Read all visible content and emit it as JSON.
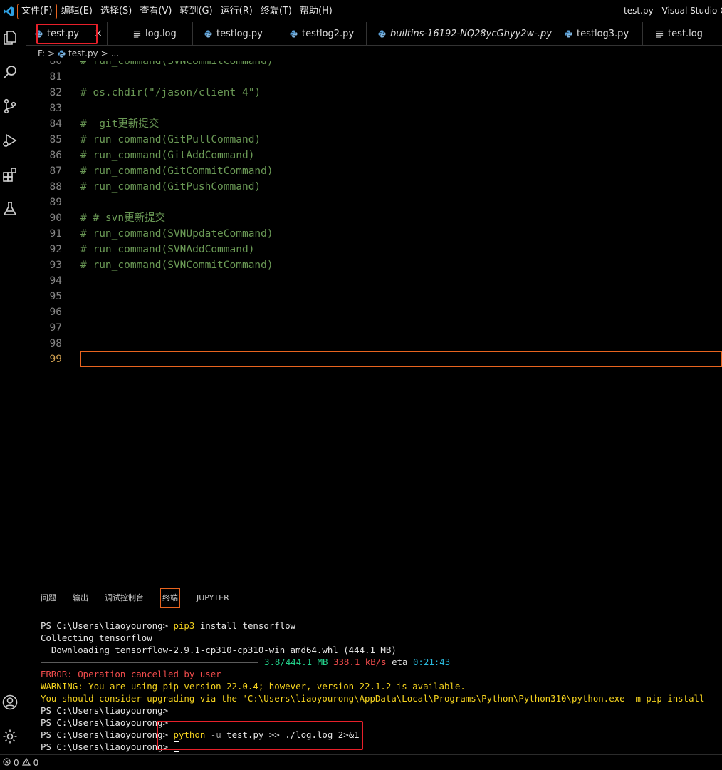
{
  "menu": {
    "items": [
      "文件(F)",
      "编辑(E)",
      "选择(S)",
      "查看(V)",
      "转到(G)",
      "运行(R)",
      "终端(T)",
      "帮助(H)"
    ],
    "window_title": "test.py - Visual Studio Code"
  },
  "tabs": [
    {
      "label": "test.py",
      "icon": "python-file-icon",
      "italic": false
    },
    {
      "label": "log.log",
      "icon": "text-file-icon",
      "italic": false
    },
    {
      "label": "testlog.py",
      "icon": "python-file-icon",
      "italic": false
    },
    {
      "label": "testlog2.py",
      "icon": "python-file-icon",
      "italic": false
    },
    {
      "label": "builtins-16192-NQ28ycGhyy2w-.py",
      "icon": "python-file-icon",
      "italic": true
    },
    {
      "label": "testlog3.py",
      "icon": "python-file-icon",
      "italic": false
    },
    {
      "label": "test.log",
      "icon": "text-file-icon",
      "italic": false
    }
  ],
  "tab_close": "×",
  "breadcrumb": {
    "drive": "F:",
    "sep": ">",
    "file": "test.py",
    "more": "..."
  },
  "editor": {
    "lines": [
      {
        "num": "80",
        "code": "# run_command(SVNCommitCommand)"
      },
      {
        "num": "81",
        "code": ""
      },
      {
        "num": "82",
        "code": "# os.chdir(\"/jason/client_4\")"
      },
      {
        "num": "83",
        "code": ""
      },
      {
        "num": "84",
        "code": "#  git更新提交"
      },
      {
        "num": "85",
        "code": "# run_command(GitPullCommand)"
      },
      {
        "num": "86",
        "code": "# run_command(GitAddCommand)"
      },
      {
        "num": "87",
        "code": "# run_command(GitCommitCommand)"
      },
      {
        "num": "88",
        "code": "# run_command(GitPushCommand)"
      },
      {
        "num": "89",
        "code": ""
      },
      {
        "num": "90",
        "code": "# # svn更新提交"
      },
      {
        "num": "91",
        "code": "# run_command(SVNUpdateCommand)"
      },
      {
        "num": "92",
        "code": "# run_command(SVNAddCommand)"
      },
      {
        "num": "93",
        "code": "# run_command(SVNCommitCommand)"
      },
      {
        "num": "94",
        "code": ""
      },
      {
        "num": "95",
        "code": ""
      },
      {
        "num": "96",
        "code": ""
      },
      {
        "num": "97",
        "code": ""
      },
      {
        "num": "98",
        "code": ""
      },
      {
        "num": "99",
        "code": ""
      }
    ],
    "current_line": "99"
  },
  "panel": {
    "tabs": [
      "问题",
      "输出",
      "调试控制台",
      "终端",
      "JUPYTER"
    ],
    "active_tab": "终端"
  },
  "terminal": {
    "prompt": "PS C:\\Users\\liaoyourong>",
    "l1_cmd": "pip3",
    "l1_args": "install tensorflow",
    "l2": "Collecting tensorflow",
    "l3": "  Downloading tensorflow-2.9.1-cp310-cp310-win_amd64.whl (444.1 MB)",
    "l4_size": "3.8/444.1 MB",
    "l4_speed": "338.1 kB/s",
    "l4_eta_label": "eta",
    "l4_eta": "0:21:43",
    "l5": "ERROR: Operation cancelled by user",
    "l6": "WARNING: You are using pip version 22.0.4; however, version 22.1.2 is available.",
    "l7": "You should consider upgrading via the 'C:\\Users\\liaoyourong\\AppData\\Local\\Programs\\Python\\Python310\\python.exe -m pip install --upgrade pip' command.",
    "l10_cmd": "python",
    "l10_flag": "-u",
    "l10_args": "test.py >> ./log.log 2>&1"
  },
  "status": {
    "errors": "0",
    "warnings": "0"
  }
}
